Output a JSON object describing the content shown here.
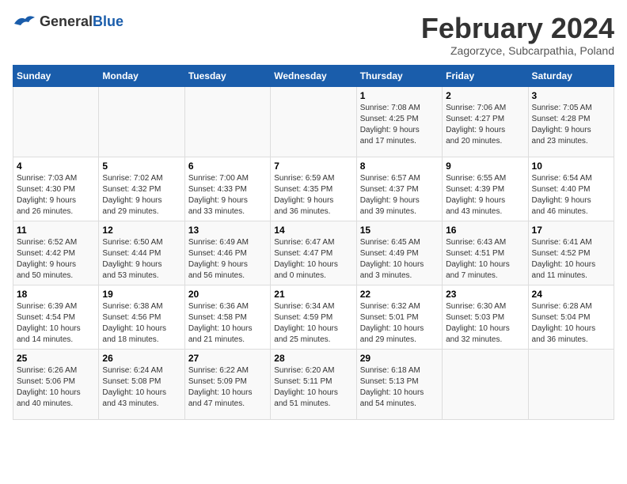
{
  "logo": {
    "text_general": "General",
    "text_blue": "Blue"
  },
  "header": {
    "title": "February 2024",
    "subtitle": "Zagorzyce, Subcarpathia, Poland"
  },
  "days_of_week": [
    "Sunday",
    "Monday",
    "Tuesday",
    "Wednesday",
    "Thursday",
    "Friday",
    "Saturday"
  ],
  "weeks": [
    [
      {
        "day": "",
        "info": ""
      },
      {
        "day": "",
        "info": ""
      },
      {
        "day": "",
        "info": ""
      },
      {
        "day": "",
        "info": ""
      },
      {
        "day": "1",
        "info": "Sunrise: 7:08 AM\nSunset: 4:25 PM\nDaylight: 9 hours\nand 17 minutes."
      },
      {
        "day": "2",
        "info": "Sunrise: 7:06 AM\nSunset: 4:27 PM\nDaylight: 9 hours\nand 20 minutes."
      },
      {
        "day": "3",
        "info": "Sunrise: 7:05 AM\nSunset: 4:28 PM\nDaylight: 9 hours\nand 23 minutes."
      }
    ],
    [
      {
        "day": "4",
        "info": "Sunrise: 7:03 AM\nSunset: 4:30 PM\nDaylight: 9 hours\nand 26 minutes."
      },
      {
        "day": "5",
        "info": "Sunrise: 7:02 AM\nSunset: 4:32 PM\nDaylight: 9 hours\nand 29 minutes."
      },
      {
        "day": "6",
        "info": "Sunrise: 7:00 AM\nSunset: 4:33 PM\nDaylight: 9 hours\nand 33 minutes."
      },
      {
        "day": "7",
        "info": "Sunrise: 6:59 AM\nSunset: 4:35 PM\nDaylight: 9 hours\nand 36 minutes."
      },
      {
        "day": "8",
        "info": "Sunrise: 6:57 AM\nSunset: 4:37 PM\nDaylight: 9 hours\nand 39 minutes."
      },
      {
        "day": "9",
        "info": "Sunrise: 6:55 AM\nSunset: 4:39 PM\nDaylight: 9 hours\nand 43 minutes."
      },
      {
        "day": "10",
        "info": "Sunrise: 6:54 AM\nSunset: 4:40 PM\nDaylight: 9 hours\nand 46 minutes."
      }
    ],
    [
      {
        "day": "11",
        "info": "Sunrise: 6:52 AM\nSunset: 4:42 PM\nDaylight: 9 hours\nand 50 minutes."
      },
      {
        "day": "12",
        "info": "Sunrise: 6:50 AM\nSunset: 4:44 PM\nDaylight: 9 hours\nand 53 minutes."
      },
      {
        "day": "13",
        "info": "Sunrise: 6:49 AM\nSunset: 4:46 PM\nDaylight: 9 hours\nand 56 minutes."
      },
      {
        "day": "14",
        "info": "Sunrise: 6:47 AM\nSunset: 4:47 PM\nDaylight: 10 hours\nand 0 minutes."
      },
      {
        "day": "15",
        "info": "Sunrise: 6:45 AM\nSunset: 4:49 PM\nDaylight: 10 hours\nand 3 minutes."
      },
      {
        "day": "16",
        "info": "Sunrise: 6:43 AM\nSunset: 4:51 PM\nDaylight: 10 hours\nand 7 minutes."
      },
      {
        "day": "17",
        "info": "Sunrise: 6:41 AM\nSunset: 4:52 PM\nDaylight: 10 hours\nand 11 minutes."
      }
    ],
    [
      {
        "day": "18",
        "info": "Sunrise: 6:39 AM\nSunset: 4:54 PM\nDaylight: 10 hours\nand 14 minutes."
      },
      {
        "day": "19",
        "info": "Sunrise: 6:38 AM\nSunset: 4:56 PM\nDaylight: 10 hours\nand 18 minutes."
      },
      {
        "day": "20",
        "info": "Sunrise: 6:36 AM\nSunset: 4:58 PM\nDaylight: 10 hours\nand 21 minutes."
      },
      {
        "day": "21",
        "info": "Sunrise: 6:34 AM\nSunset: 4:59 PM\nDaylight: 10 hours\nand 25 minutes."
      },
      {
        "day": "22",
        "info": "Sunrise: 6:32 AM\nSunset: 5:01 PM\nDaylight: 10 hours\nand 29 minutes."
      },
      {
        "day": "23",
        "info": "Sunrise: 6:30 AM\nSunset: 5:03 PM\nDaylight: 10 hours\nand 32 minutes."
      },
      {
        "day": "24",
        "info": "Sunrise: 6:28 AM\nSunset: 5:04 PM\nDaylight: 10 hours\nand 36 minutes."
      }
    ],
    [
      {
        "day": "25",
        "info": "Sunrise: 6:26 AM\nSunset: 5:06 PM\nDaylight: 10 hours\nand 40 minutes."
      },
      {
        "day": "26",
        "info": "Sunrise: 6:24 AM\nSunset: 5:08 PM\nDaylight: 10 hours\nand 43 minutes."
      },
      {
        "day": "27",
        "info": "Sunrise: 6:22 AM\nSunset: 5:09 PM\nDaylight: 10 hours\nand 47 minutes."
      },
      {
        "day": "28",
        "info": "Sunrise: 6:20 AM\nSunset: 5:11 PM\nDaylight: 10 hours\nand 51 minutes."
      },
      {
        "day": "29",
        "info": "Sunrise: 6:18 AM\nSunset: 5:13 PM\nDaylight: 10 hours\nand 54 minutes."
      },
      {
        "day": "",
        "info": ""
      },
      {
        "day": "",
        "info": ""
      }
    ]
  ]
}
